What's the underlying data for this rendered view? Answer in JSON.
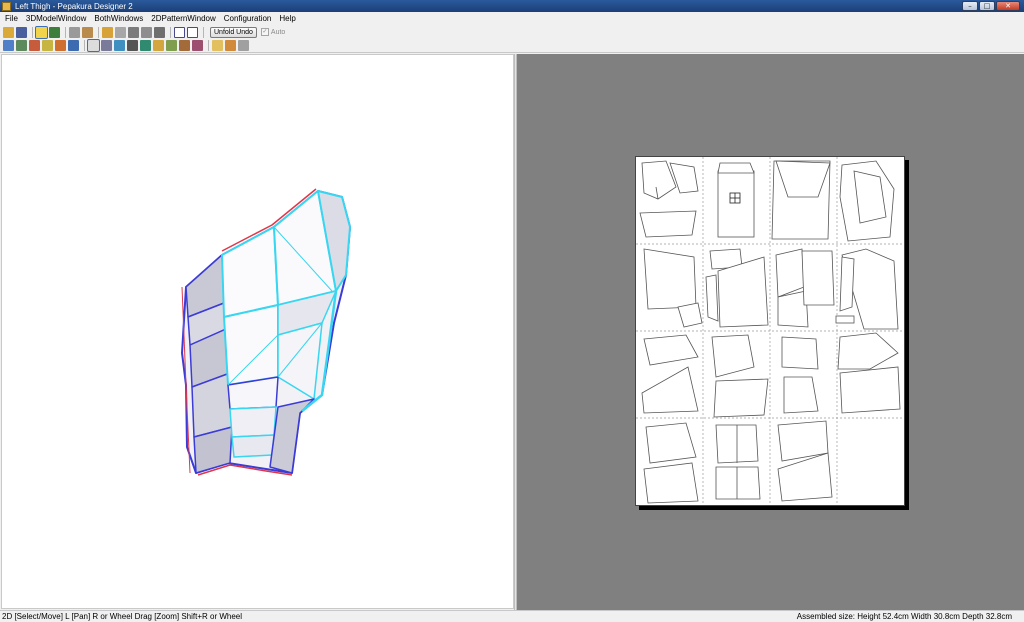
{
  "window": {
    "title": "Left Thigh - Pepakura Designer 2",
    "controls": {
      "minimize": "–",
      "maximize": "□",
      "close": "✕"
    }
  },
  "menu": [
    "File",
    "3DModelWindow",
    "BothWindows",
    "2DPatternWindow",
    "Configuration",
    "Help"
  ],
  "toolbar": {
    "unfold_undo_label": "Unfold Undo",
    "auto_label": "Auto",
    "auto_checked": true,
    "auto_enabled": false,
    "row1_icons": [
      "open-icon",
      "save-icon",
      "separator",
      "unfold-icon",
      "textured-icon",
      "separator",
      "cube-icon",
      "cube-side-icon",
      "separator",
      "pencil-icon",
      "edge-icon",
      "rotate-icon",
      "mirror-icon",
      "scale-icon",
      "separator",
      "window-icon",
      "window-wide-icon"
    ],
    "row2_icons": [
      "fit-icon",
      "pan-icon",
      "brush-icon",
      "line-icon",
      "image-icon",
      "text-icon",
      "separator",
      "select-icon",
      "layout-icon",
      "edit-icon",
      "join-icon",
      "arrange-icon",
      "fold-icon",
      "photo-icon",
      "export-icon",
      "undo-flaps-icon",
      "separator",
      "print-icon",
      "page-icon",
      "print-setup-icon"
    ]
  },
  "status": {
    "left": "2D [Select/Move] L [Pan] R or Wheel Drag [Zoom] Shift+R or Wheel",
    "right": "Assembled size: Height 52.4cm Width 30.8cm Depth 32.8cm"
  },
  "colors": {
    "titlebar": "#2a5a9b",
    "view2d_bg": "#808080",
    "model_edge_cyan": "#38d6f0",
    "model_edge_red": "#e0364a",
    "model_edge_blue": "#3b3bd6"
  }
}
